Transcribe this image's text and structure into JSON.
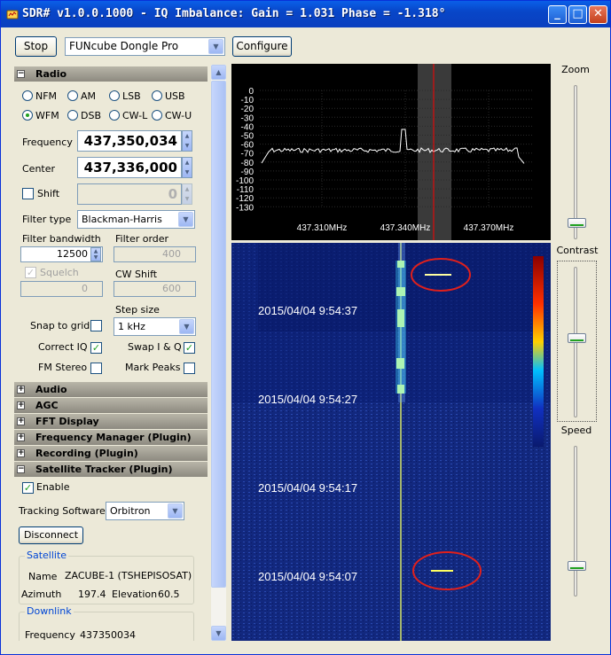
{
  "window": {
    "title": "SDR# v1.0.0.1000 - IQ Imbalance: Gain = 1.031 Phase = -1.318°",
    "minimize": "_",
    "maximize": "□",
    "close": "✕"
  },
  "toolbar": {
    "stop_label": "Stop",
    "device": "FUNcube Dongle Pro",
    "configure_label": "Configure"
  },
  "radio": {
    "header": "Radio",
    "modes_row1": [
      "NFM",
      "AM",
      "LSB",
      "USB"
    ],
    "modes_row2": [
      "WFM",
      "DSB",
      "CW-L",
      "CW-U"
    ],
    "selected_mode": "WFM",
    "frequency_label": "Frequency",
    "frequency": "437,350,034",
    "center_label": "Center",
    "center": "437,336,000",
    "shift_label": "Shift",
    "shift": "0",
    "filter_type_label": "Filter type",
    "filter_type": "Blackman-Harris",
    "filter_bandwidth_label": "Filter bandwidth",
    "filter_bandwidth": "12500",
    "filter_order_label": "Filter order",
    "filter_order": "400",
    "squelch_label": "Squelch",
    "squelch": "0",
    "cw_shift_label": "CW Shift",
    "cw_shift": "600",
    "step_size_label": "Step size",
    "step_size": "1 kHz",
    "snap_to_grid_label": "Snap to grid",
    "correct_iq_label": "Correct IQ",
    "swap_iq_label": "Swap I & Q",
    "fm_stereo_label": "FM Stereo",
    "mark_peaks_label": "Mark Peaks"
  },
  "sections": [
    "Audio",
    "AGC",
    "FFT Display",
    "Frequency Manager (Plugin)",
    "Recording (Plugin)",
    "Satellite Tracker (Plugin)"
  ],
  "satellite_tracker": {
    "enable_label": "Enable",
    "tracking_software_label": "Tracking Software",
    "tracking_software": "Orbitron",
    "disconnect_label": "Disconnect",
    "satellite_group": "Satellite",
    "name_label": "Name",
    "name": "ZACUBE-1 (TSHEPISOSAT)",
    "azimuth_label": "Azimuth",
    "azimuth": "197.4",
    "elevation_label": "Elevation",
    "elevation": "60.5",
    "downlink_group": "Downlink",
    "frequency_label": "Frequency",
    "frequency": "437350034"
  },
  "spectrum": {
    "db_ticks": [
      "0",
      "-10",
      "-20",
      "-30",
      "-40",
      "-50",
      "-60",
      "-70",
      "-80",
      "-90",
      "-100",
      "-110",
      "-120",
      "-130"
    ],
    "freq_ticks": [
      "437.310MHz",
      "437.340MHz",
      "437.370MHz"
    ]
  },
  "waterfall": {
    "timestamps": [
      "2015/04/04 9:54:37",
      "2015/04/04 9:54:27",
      "2015/04/04 9:54:17",
      "2015/04/04 9:54:07"
    ]
  },
  "sliders": {
    "zoom_label": "Zoom",
    "contrast_label": "Contrast",
    "speed_label": "Speed",
    "zoom_level": 0.05,
    "contrast_level": 0.5,
    "speed_level": 0.15
  },
  "colors": {
    "accent": "#0046d5",
    "tuning_line": "#ff0000",
    "marker_ellipse": "#e0201c",
    "checkmark": "#21a121"
  }
}
